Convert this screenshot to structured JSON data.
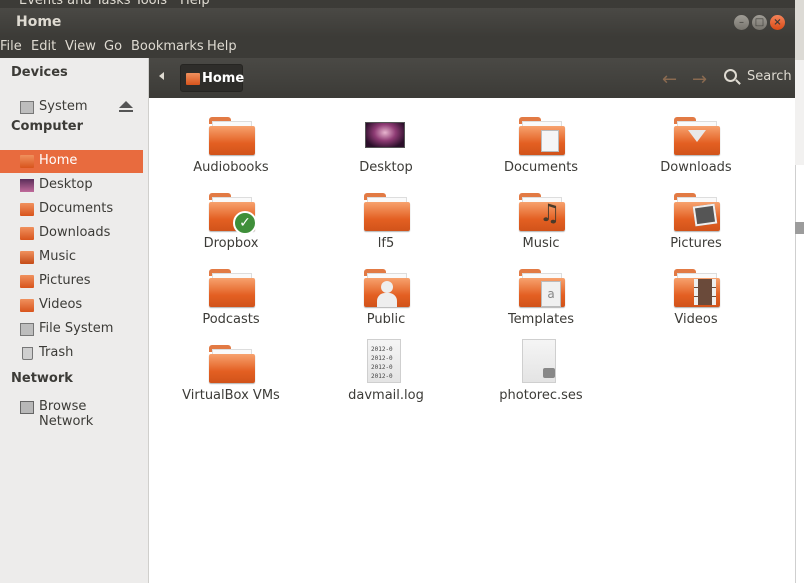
{
  "background_app": {
    "menu": [
      "Events and Tasks",
      "Tools",
      "Help"
    ]
  },
  "window": {
    "title": "Home"
  },
  "menubar": [
    "File",
    "Edit",
    "View",
    "Go",
    "Bookmarks",
    "Help"
  ],
  "sidebar": {
    "sections": [
      {
        "heading": "Devices",
        "items": [
          {
            "label": "System",
            "icon": "drive-icon"
          }
        ]
      },
      {
        "heading": "Computer",
        "items": [
          {
            "label": "Home",
            "icon": "home-folder-icon",
            "active": true
          },
          {
            "label": "Desktop",
            "icon": "desktop-folder-icon"
          },
          {
            "label": "Documents",
            "icon": "documents-folder-icon"
          },
          {
            "label": "Downloads",
            "icon": "downloads-folder-icon"
          },
          {
            "label": "Music",
            "icon": "music-folder-icon"
          },
          {
            "label": "Pictures",
            "icon": "pictures-folder-icon"
          },
          {
            "label": "Videos",
            "icon": "videos-folder-icon"
          },
          {
            "label": "File System",
            "icon": "filesystem-icon"
          },
          {
            "label": "Trash",
            "icon": "trash-icon"
          }
        ]
      },
      {
        "heading": "Network",
        "items": [
          {
            "label": "Browse Network",
            "icon": "network-icon"
          }
        ]
      }
    ]
  },
  "toolbar": {
    "breadcrumb": "Home",
    "search_label": "Search"
  },
  "files": [
    {
      "name": "Audiobooks",
      "type": "folder"
    },
    {
      "name": "Desktop",
      "type": "desktop"
    },
    {
      "name": "Documents",
      "type": "folder",
      "emblem": "document"
    },
    {
      "name": "Downloads",
      "type": "folder",
      "emblem": "download"
    },
    {
      "name": "Dropbox",
      "type": "folder",
      "emblem": "check"
    },
    {
      "name": "lf5",
      "type": "folder"
    },
    {
      "name": "Music",
      "type": "folder",
      "emblem": "music"
    },
    {
      "name": "Pictures",
      "type": "folder",
      "emblem": "picture"
    },
    {
      "name": "Podcasts",
      "type": "folder"
    },
    {
      "name": "Public",
      "type": "folder",
      "emblem": "person"
    },
    {
      "name": "Templates",
      "type": "folder",
      "emblem": "template"
    },
    {
      "name": "Videos",
      "type": "folder",
      "emblem": "film"
    },
    {
      "name": "VirtualBox VMs",
      "type": "folder"
    },
    {
      "name": "davmail.log",
      "type": "text",
      "preview": "2012-0\n2012-0\n2012-0\n2012-0"
    },
    {
      "name": "photorec.ses",
      "type": "locked"
    }
  ],
  "colors": {
    "accent": "#e86b3e",
    "titlebar": "#3c3b37"
  }
}
